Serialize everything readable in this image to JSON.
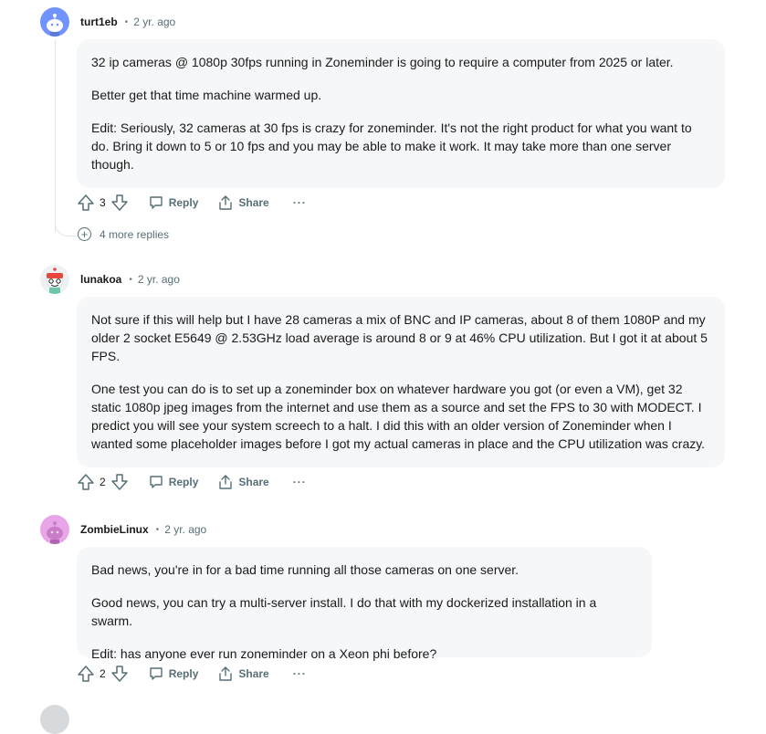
{
  "comments": [
    {
      "username": "turt1eb",
      "separator": "•",
      "time": "2 yr. ago",
      "paragraphs": [
        "32 ip cameras @ 1080p 30fps running in Zoneminder is going to require a computer from 2025 or later.",
        "Better get that time machine warmed up.",
        "Edit: Seriously, 32 cameras at 30 fps is crazy for zoneminder. It's not the right product for what you want to do. Bring it down to 5 or 10 fps and you may be able to make it work. It may take more than one server though."
      ],
      "votes": "3",
      "reply_label": "Reply",
      "share_label": "Share",
      "more_label": "···",
      "more_replies": "4 more replies",
      "avatar_color": "#7193ff"
    },
    {
      "username": "lunakoa",
      "separator": "•",
      "time": "2 yr. ago",
      "paragraphs": [
        "Not sure if this will help but I have 28 cameras a mix of BNC and IP cameras, about 8 of them 1080P and my older 2 socket E5649 @ 2.53GHz load average is around 8 or 9 at 46% CPU utilization. But I got it at about 5 FPS.",
        "One test you can do is to set up a zoneminder box on whatever hardware you got (or even a VM), get 32 static 1080p jpeg images from the internet and use them as a source and set the FPS to 30 with MODECT. I predict you will see your system screech to a halt. I did this with an older version of Zoneminder when I wanted some placeholder images before I got my actual cameras in place and the CPU utilization was crazy."
      ],
      "votes": "2",
      "reply_label": "Reply",
      "share_label": "Share",
      "more_label": "···",
      "avatar_color": "#ff4500"
    },
    {
      "username": "ZombieLinux",
      "separator": "•",
      "time": "2 yr. ago",
      "paragraphs": [
        "Bad news, you're in for a bad time running all those cameras on one server.",
        "Good news, you can try a multi-server install. I do that with my dockerized installation in a swarm.",
        "Edit: has anyone ever run zoneminder on a Xeon phi before?"
      ],
      "votes": "2",
      "reply_label": "Reply",
      "share_label": "Share",
      "more_label": "···",
      "avatar_color": "#e8a6e8"
    }
  ]
}
